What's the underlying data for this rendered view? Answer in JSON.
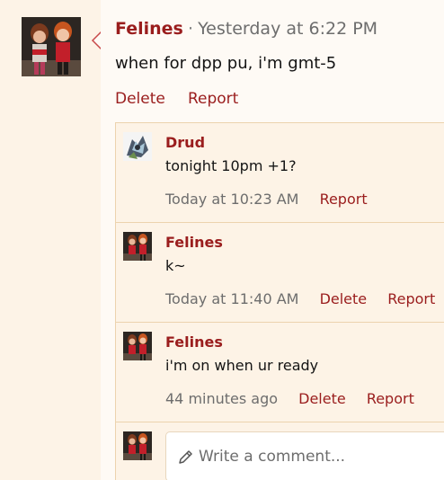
{
  "post": {
    "author": "Felines",
    "separator": "·",
    "time": "Yesterday at 6:22 PM",
    "body": "when for dpp pu, i'm gmt-5",
    "actions": {
      "delete": "Delete",
      "report": "Report"
    }
  },
  "comments": [
    {
      "author": "Drud",
      "avatar_icon": "drud-avatar",
      "text": "tonight 10pm +1?",
      "time": "Today at 10:23 AM",
      "delete": "",
      "report": "Report"
    },
    {
      "author": "Felines",
      "avatar_icon": "felines-avatar",
      "text": "k~",
      "time": "Today at 11:40 AM",
      "delete": "Delete",
      "report": "Report"
    },
    {
      "author": "Felines",
      "avatar_icon": "felines-avatar",
      "text": "i'm on when ur ready",
      "time": "44 minutes ago",
      "delete": "Delete",
      "report": "Report"
    }
  ],
  "composer": {
    "placeholder": "Write a comment...",
    "icon": "pencil-icon"
  },
  "colors": {
    "accent": "#9a1d1d",
    "background": "#fdf3e7",
    "border": "#ecd3ae"
  }
}
